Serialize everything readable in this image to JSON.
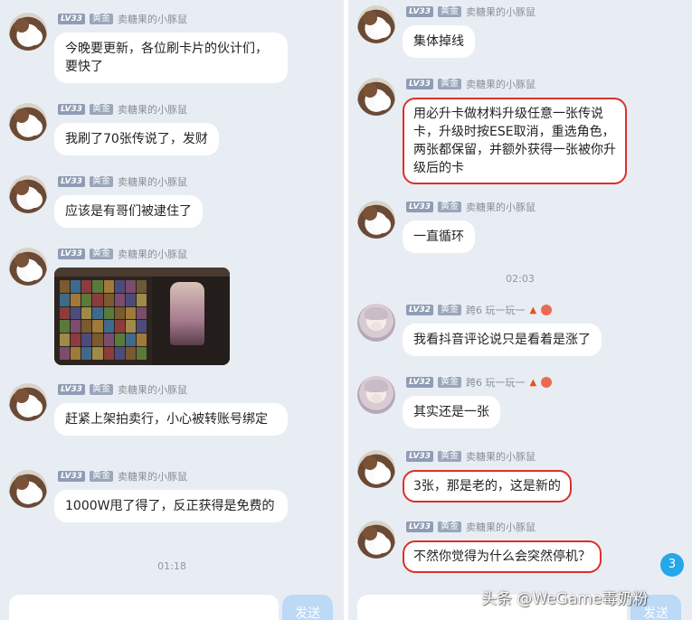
{
  "sender": {
    "level": "LV33",
    "rank": "黄金",
    "name": "卖糖果的小豚鼠"
  },
  "sender2": {
    "level": "LV32",
    "rank": "黄金",
    "name": "跨6 玩一玩一"
  },
  "left": {
    "messages": [
      {
        "text": "今晚要更新，各位刷卡片的伙计们，要快了"
      },
      {
        "text": "我刷了70张传说了，发财"
      },
      {
        "text": "应该是有哥们被逮住了"
      },
      {
        "text": ""
      },
      {
        "text": "赶紧上架拍卖行，小心被转账号绑定"
      },
      {
        "text": "1000W甩了得了，反正获得是免费的"
      }
    ],
    "time": "01:18",
    "send_label": "发送"
  },
  "right": {
    "messages": [
      {
        "text": "集体掉线"
      },
      {
        "text": "用必升卡做材料升级任意一张传说卡，升级时按ESE取消，重选角色，两张都保留，并额外获得一张被你升级后的卡"
      },
      {
        "text": "一直循环"
      },
      {
        "text": "我看抖音评论说只是看着是涨了"
      },
      {
        "text": "其实还是一张"
      },
      {
        "text": "3张，那是老的，这是新的"
      },
      {
        "text": "不然你觉得为什么会突然停机？"
      }
    ],
    "time": "02:03",
    "send_label": "发送"
  },
  "float_badge": "3",
  "watermark": "头条 @WeGame毒奶粉",
  "colors": {
    "highlight_box": "#d9302b",
    "send_button": "#bcd9f6",
    "badge": "#25a7e8",
    "panel_bg": "#e8edf4"
  },
  "icons": {
    "flame": "flame-icon",
    "heart": "heart-badge-icon"
  }
}
